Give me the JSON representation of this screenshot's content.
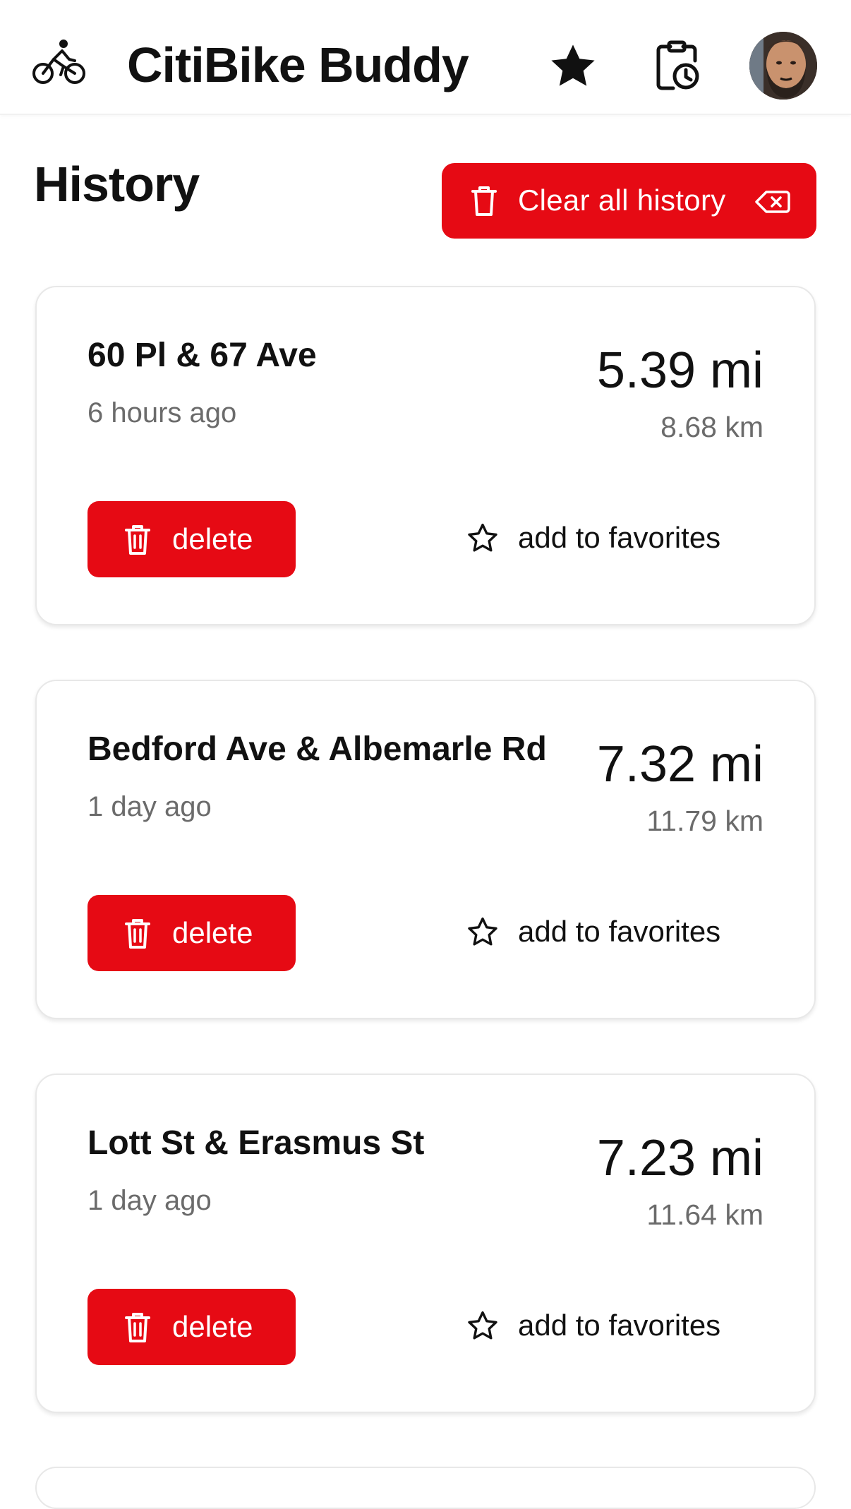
{
  "header": {
    "app_title": "CitiBike Buddy",
    "icons": {
      "logo": "bicycle-rider-icon",
      "favorites": "star-filled-icon",
      "history": "clipboard-clock-icon",
      "profile": "user-avatar"
    }
  },
  "page": {
    "heading": "History",
    "clear_button_label": "Clear all history"
  },
  "trips": [
    {
      "station": "60 Pl & 67 Ave",
      "time_ago": "6 hours ago",
      "miles": "5.39 mi",
      "km": "8.68 km",
      "delete_label": "delete",
      "favorite_label": "add to favorites"
    },
    {
      "station": "Bedford Ave & Albemarle Rd",
      "time_ago": "1 day ago",
      "miles": "7.32 mi",
      "km": "11.79 km",
      "delete_label": "delete",
      "favorite_label": "add to favorites"
    },
    {
      "station": "Lott St & Erasmus St",
      "time_ago": "1 day ago",
      "miles": "7.23 mi",
      "km": "11.64 km",
      "delete_label": "delete",
      "favorite_label": "add to favorites"
    }
  ],
  "colors": {
    "accent": "#e60a14",
    "text_primary": "#111111",
    "text_secondary": "#6b6b6b",
    "card_border": "#e8e8e8"
  }
}
